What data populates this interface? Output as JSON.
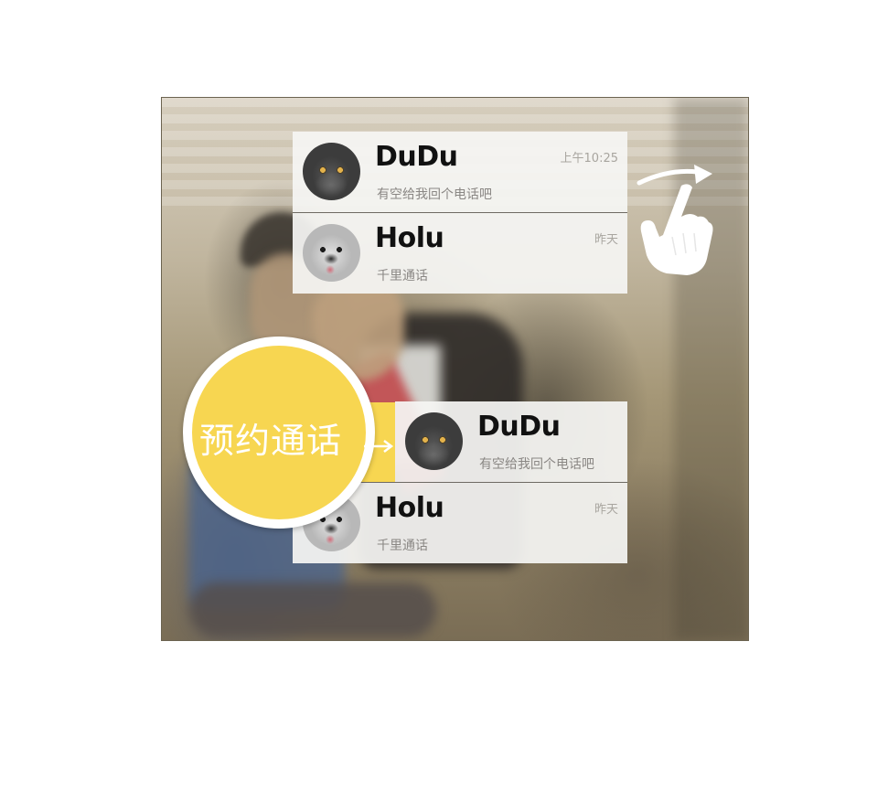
{
  "top_list": {
    "items": [
      {
        "name": "DuDu",
        "message": "有空给我回个电话吧",
        "time": "上午10:25",
        "avatar": "cat"
      },
      {
        "name": "Holu",
        "message": "千里通话",
        "time": "昨天",
        "avatar": "dog"
      }
    ]
  },
  "bottom_list": {
    "swipe_action_label": "预约通话",
    "items": [
      {
        "name": "DuDu",
        "message": "有空给我回个电话吧",
        "time": "",
        "avatar": "cat"
      },
      {
        "name": "Holu",
        "message": "千里通话",
        "time": "昨天",
        "avatar": "dog"
      }
    ]
  },
  "gesture": {
    "icon": "swipe-right-hand-icon"
  },
  "colors": {
    "accent": "#f7d651",
    "card_bg": "#f5f5f3",
    "name": "#111111",
    "muted": "#8a8784"
  }
}
